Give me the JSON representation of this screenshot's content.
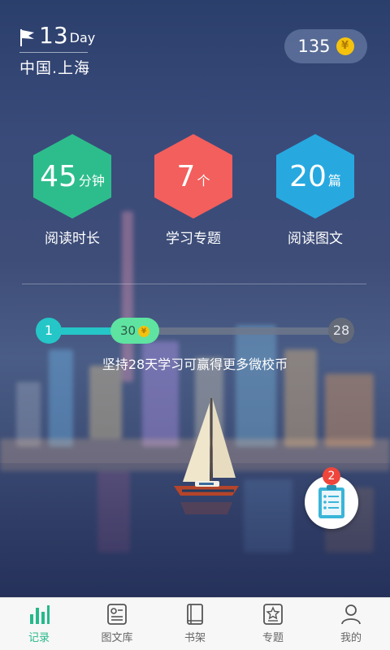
{
  "header": {
    "day_count": "13",
    "day_suffix": "Day",
    "location": "中国.上海"
  },
  "coins": {
    "value": "135",
    "coin_symbol": "¥"
  },
  "stats": [
    {
      "value": "45",
      "unit": "分钟",
      "label": "阅读时长",
      "color": "#2dbd8c"
    },
    {
      "value": "7",
      "unit": "个",
      "label": "学习专题",
      "color": "#f25f5c"
    },
    {
      "value": "20",
      "unit": "篇",
      "label": "阅读图文",
      "color": "#27a9e0"
    }
  ],
  "progress": {
    "start": "1",
    "current": "30",
    "end": "28",
    "coin_symbol": "¥",
    "fraction": 0.33,
    "caption": "坚持28天学习可赢得更多微校币"
  },
  "notifications": {
    "badge_count": "2"
  },
  "tabs": [
    {
      "label": "记录",
      "icon": "bar-chart-icon",
      "active": true
    },
    {
      "label": "图文库",
      "icon": "article-icon",
      "active": false
    },
    {
      "label": "书架",
      "icon": "book-icon",
      "active": false
    },
    {
      "label": "专题",
      "icon": "star-doc-icon",
      "active": false
    },
    {
      "label": "我的",
      "icon": "user-icon",
      "active": false
    }
  ],
  "colors": {
    "accent_green": "#26b98a",
    "progress_teal": "#25c6c7",
    "coin_gold": "#f4c20d",
    "badge_red": "#f0453b"
  }
}
